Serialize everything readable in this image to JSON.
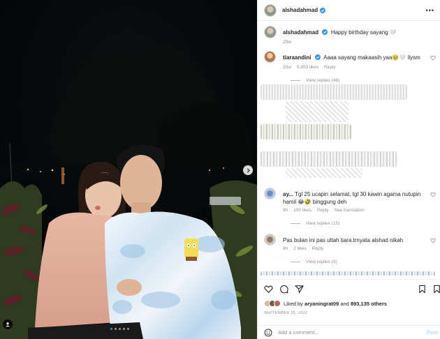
{
  "post": {
    "author": "alshadahmad",
    "caption_author": "alshadahmad",
    "caption_text": "Happy birthday sayang",
    "caption_emoji": "🤍",
    "caption_age": "25w"
  },
  "comments": [
    {
      "username": "tiaraandini",
      "text": "Aaaa sayang makaasih yaa🥹🤍 ilysm",
      "age": "25w",
      "likes": "5,853 likes",
      "reply": "Reply",
      "view_replies": "View replies (48)"
    },
    {
      "username": "ay...",
      "text": "Tgl 25 ucapin selamat, tgl 30 kawin agama nutupin hamil 😂🤣 binggung deh",
      "age": "9h",
      "likes": "190 likes",
      "reply": "Reply",
      "see_translation": "See translation",
      "view_replies": "View replies (15)"
    },
    {
      "username": "",
      "text": "Pas bulan ini pas ultah tiara.trnyata alshad nikah",
      "age": "9h",
      "likes": "2 likes",
      "reply": "Reply",
      "view_replies": "View replies (3)"
    }
  ],
  "likes": {
    "prefix": "Liked by",
    "user": "aryaningrat09",
    "middle": "and",
    "count": "893,135 others"
  },
  "date": "SEPTEMBER 25, 2022",
  "add_comment": {
    "placeholder": "Add a comment...",
    "post_label": "Post"
  },
  "icons": [
    "verified-badge-icon",
    "more-options-icon",
    "heart-icon",
    "comment-icon",
    "share-icon",
    "bookmark-icon",
    "emoji-icon",
    "next-arrow-icon",
    "user-tag-icon"
  ],
  "colors": {
    "verified": "#3897f0",
    "link_muted": "#8e8e8e",
    "post_button": "#b3dbff"
  }
}
